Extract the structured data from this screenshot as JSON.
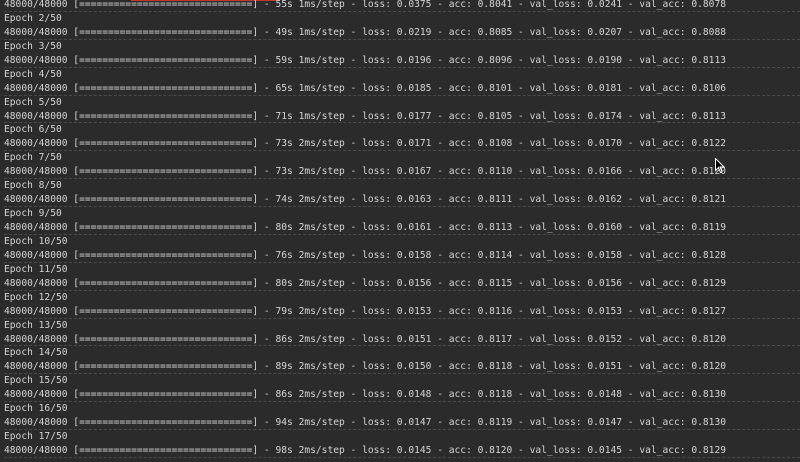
{
  "lines": [
    {
      "type": "progress",
      "text": "48000/48000 [==============================] - 55s 1ms/step - loss: 0.0375 - acc: 0.8041 - val_loss: 0.0241 - val_acc: 0.8078"
    },
    {
      "type": "epoch",
      "text": "Epoch 2/50"
    },
    {
      "type": "progress",
      "text": "48000/48000 [==============================] - 49s 1ms/step - loss: 0.0219 - acc: 0.8085 - val_loss: 0.0207 - val_acc: 0.8088"
    },
    {
      "type": "epoch",
      "text": "Epoch 3/50"
    },
    {
      "type": "progress",
      "text": "48000/48000 [==============================] - 59s 1ms/step - loss: 0.0196 - acc: 0.8096 - val_loss: 0.0190 - val_acc: 0.8113"
    },
    {
      "type": "epoch",
      "text": "Epoch 4/50"
    },
    {
      "type": "progress",
      "text": "48000/48000 [==============================] - 65s 1ms/step - loss: 0.0185 - acc: 0.8101 - val_loss: 0.0181 - val_acc: 0.8106"
    },
    {
      "type": "epoch",
      "text": "Epoch 5/50"
    },
    {
      "type": "progress",
      "text": "48000/48000 [==============================] - 71s 1ms/step - loss: 0.0177 - acc: 0.8105 - val_loss: 0.0174 - val_acc: 0.8113"
    },
    {
      "type": "epoch",
      "text": "Epoch 6/50"
    },
    {
      "type": "progress",
      "text": "48000/48000 [==============================] - 73s 2ms/step - loss: 0.0171 - acc: 0.8108 - val_loss: 0.0170 - val_acc: 0.8122"
    },
    {
      "type": "epoch",
      "text": "Epoch 7/50"
    },
    {
      "type": "progress",
      "text": "48000/48000 [==============================] - 73s 2ms/step - loss: 0.0167 - acc: 0.8110 - val_loss: 0.0166 - val_acc: 0.8120"
    },
    {
      "type": "epoch",
      "text": "Epoch 8/50"
    },
    {
      "type": "progress",
      "text": "48000/48000 [==============================] - 74s 2ms/step - loss: 0.0163 - acc: 0.8111 - val_loss: 0.0162 - val_acc: 0.8121"
    },
    {
      "type": "epoch",
      "text": "Epoch 9/50"
    },
    {
      "type": "progress",
      "text": "48000/48000 [==============================] - 80s 2ms/step - loss: 0.0161 - acc: 0.8113 - val_loss: 0.0160 - val_acc: 0.8119"
    },
    {
      "type": "epoch",
      "text": "Epoch 10/50"
    },
    {
      "type": "progress",
      "text": "48000/48000 [==============================] - 76s 2ms/step - loss: 0.0158 - acc: 0.8114 - val_loss: 0.0158 - val_acc: 0.8128"
    },
    {
      "type": "epoch",
      "text": "Epoch 11/50"
    },
    {
      "type": "progress",
      "text": "48000/48000 [==============================] - 80s 2ms/step - loss: 0.0156 - acc: 0.8115 - val_loss: 0.0156 - val_acc: 0.8129"
    },
    {
      "type": "epoch",
      "text": "Epoch 12/50"
    },
    {
      "type": "progress",
      "text": "48000/48000 [==============================] - 79s 2ms/step - loss: 0.0153 - acc: 0.8116 - val_loss: 0.0153 - val_acc: 0.8127"
    },
    {
      "type": "epoch",
      "text": "Epoch 13/50"
    },
    {
      "type": "progress",
      "text": "48000/48000 [==============================] - 86s 2ms/step - loss: 0.0151 - acc: 0.8117 - val_loss: 0.0152 - val_acc: 0.8120"
    },
    {
      "type": "epoch",
      "text": "Epoch 14/50"
    },
    {
      "type": "progress",
      "text": "48000/48000 [==============================] - 89s 2ms/step - loss: 0.0150 - acc: 0.8118 - val_loss: 0.0151 - val_acc: 0.8120"
    },
    {
      "type": "epoch",
      "text": "Epoch 15/50"
    },
    {
      "type": "progress",
      "text": "48000/48000 [==============================] - 86s 2ms/step - loss: 0.0148 - acc: 0.8118 - val_loss: 0.0148 - val_acc: 0.8130"
    },
    {
      "type": "epoch",
      "text": "Epoch 16/50"
    },
    {
      "type": "progress",
      "text": "48000/48000 [==============================] - 94s 2ms/step - loss: 0.0147 - acc: 0.8119 - val_loss: 0.0147 - val_acc: 0.8130"
    },
    {
      "type": "epoch",
      "text": "Epoch 17/50"
    },
    {
      "type": "progress",
      "text": "48000/48000 [==============================] - 98s 2ms/step - loss: 0.0145 - acc: 0.8120 - val_loss: 0.0145 - val_acc: 0.8129"
    }
  ],
  "icons": {
    "cursor": "mouse-pointer-icon"
  },
  "colors": {
    "background": "#2b2b2b",
    "text": "#d4d4d4",
    "accent": "#c0392b"
  }
}
